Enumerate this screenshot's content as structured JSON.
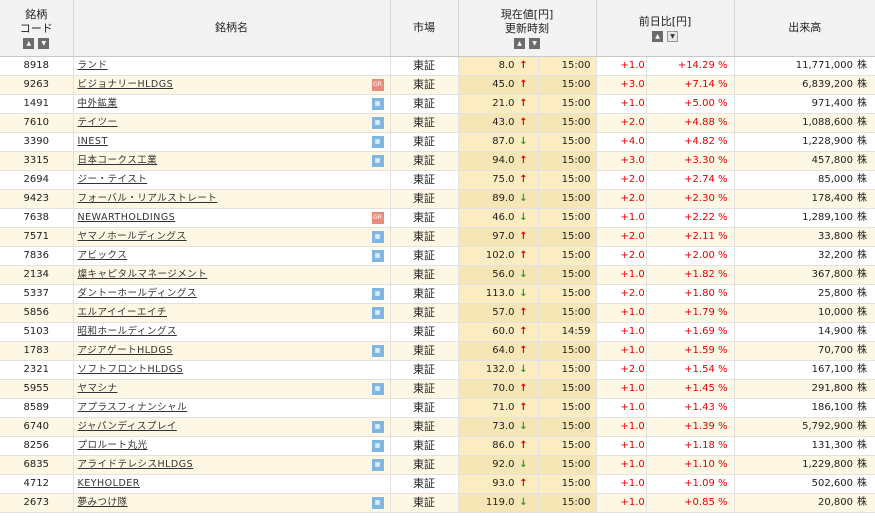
{
  "header": {
    "code_line1": "銘柄",
    "code_line2": "コード",
    "name": "銘柄名",
    "market": "市場",
    "price_line1": "現在値[円]",
    "price_line2": "更新時刻",
    "change": "前日比[円]",
    "volume": "出来高"
  },
  "volume_unit": "株",
  "rows": [
    {
      "code": "8918",
      "name": "ランド",
      "badge": "",
      "market": "東証",
      "price": "8.0",
      "dir": "up",
      "time": "15:00",
      "change": "+1.0",
      "pct": "+14.29 %",
      "volume": "11,771,000"
    },
    {
      "code": "9263",
      "name": "ビジョナリーHLDGS",
      "badge": "GR",
      "market": "東証",
      "price": "45.0",
      "dir": "up",
      "time": "15:00",
      "change": "+3.0",
      "pct": "+7.14 %",
      "volume": "6,839,200"
    },
    {
      "code": "1491",
      "name": "中外鉱業",
      "badge": "chart",
      "market": "東証",
      "price": "21.0",
      "dir": "up",
      "time": "15:00",
      "change": "+1.0",
      "pct": "+5.00 %",
      "volume": "971,400"
    },
    {
      "code": "7610",
      "name": "テイツー",
      "badge": "chart",
      "market": "東証",
      "price": "43.0",
      "dir": "up",
      "time": "15:00",
      "change": "+2.0",
      "pct": "+4.88 %",
      "volume": "1,088,600"
    },
    {
      "code": "3390",
      "name": "INEST",
      "badge": "chart",
      "market": "東証",
      "price": "87.0",
      "dir": "down",
      "time": "15:00",
      "change": "+4.0",
      "pct": "+4.82 %",
      "volume": "1,228,900"
    },
    {
      "code": "3315",
      "name": "日本コークス工業",
      "badge": "chart",
      "market": "東証",
      "price": "94.0",
      "dir": "up",
      "time": "15:00",
      "change": "+3.0",
      "pct": "+3.30 %",
      "volume": "457,800"
    },
    {
      "code": "2694",
      "name": "ジー・テイスト",
      "badge": "",
      "market": "東証",
      "price": "75.0",
      "dir": "up",
      "time": "15:00",
      "change": "+2.0",
      "pct": "+2.74 %",
      "volume": "85,000"
    },
    {
      "code": "9423",
      "name": "フォーバル・リアルストレート",
      "badge": "",
      "market": "東証",
      "price": "89.0",
      "dir": "down",
      "time": "15:00",
      "change": "+2.0",
      "pct": "+2.30 %",
      "volume": "178,400"
    },
    {
      "code": "7638",
      "name": "NEWARTHOLDINGS",
      "badge": "GR",
      "market": "東証",
      "price": "46.0",
      "dir": "down",
      "time": "15:00",
      "change": "+1.0",
      "pct": "+2.22 %",
      "volume": "1,289,100"
    },
    {
      "code": "7571",
      "name": "ヤマノホールディングス",
      "badge": "chart",
      "market": "東証",
      "price": "97.0",
      "dir": "up",
      "time": "15:00",
      "change": "+2.0",
      "pct": "+2.11 %",
      "volume": "33,800"
    },
    {
      "code": "7836",
      "name": "アビックス",
      "badge": "chart",
      "market": "東証",
      "price": "102.0",
      "dir": "up",
      "time": "15:00",
      "change": "+2.0",
      "pct": "+2.00 %",
      "volume": "32,200"
    },
    {
      "code": "2134",
      "name": "燦キャピタルマネージメント",
      "badge": "",
      "market": "東証",
      "price": "56.0",
      "dir": "down",
      "time": "15:00",
      "change": "+1.0",
      "pct": "+1.82 %",
      "volume": "367,800"
    },
    {
      "code": "5337",
      "name": "ダントーホールディングス",
      "badge": "chart",
      "market": "東証",
      "price": "113.0",
      "dir": "down",
      "time": "15:00",
      "change": "+2.0",
      "pct": "+1.80 %",
      "volume": "25,800"
    },
    {
      "code": "5856",
      "name": "エルアイイーエイチ",
      "badge": "chart",
      "market": "東証",
      "price": "57.0",
      "dir": "up",
      "time": "15:00",
      "change": "+1.0",
      "pct": "+1.79 %",
      "volume": "10,000"
    },
    {
      "code": "5103",
      "name": "昭和ホールディングス",
      "badge": "",
      "market": "東証",
      "price": "60.0",
      "dir": "up",
      "time": "14:59",
      "change": "+1.0",
      "pct": "+1.69 %",
      "volume": "14,900"
    },
    {
      "code": "1783",
      "name": "アジアゲートHLDGS",
      "badge": "chart",
      "market": "東証",
      "price": "64.0",
      "dir": "up",
      "time": "15:00",
      "change": "+1.0",
      "pct": "+1.59 %",
      "volume": "70,700"
    },
    {
      "code": "2321",
      "name": "ソフトフロントHLDGS",
      "badge": "",
      "market": "東証",
      "price": "132.0",
      "dir": "down",
      "time": "15:00",
      "change": "+2.0",
      "pct": "+1.54 %",
      "volume": "167,100"
    },
    {
      "code": "5955",
      "name": "ヤマシナ",
      "badge": "chart",
      "market": "東証",
      "price": "70.0",
      "dir": "up",
      "time": "15:00",
      "change": "+1.0",
      "pct": "+1.45 %",
      "volume": "291,800"
    },
    {
      "code": "8589",
      "name": "アプラスフィナンシャル",
      "badge": "",
      "market": "東証",
      "price": "71.0",
      "dir": "up",
      "time": "15:00",
      "change": "+1.0",
      "pct": "+1.43 %",
      "volume": "186,100"
    },
    {
      "code": "6740",
      "name": "ジャパンディスプレイ",
      "badge": "chart",
      "market": "東証",
      "price": "73.0",
      "dir": "down",
      "time": "15:00",
      "change": "+1.0",
      "pct": "+1.39 %",
      "volume": "5,792,900"
    },
    {
      "code": "8256",
      "name": "プロルート丸光",
      "badge": "chart",
      "market": "東証",
      "price": "86.0",
      "dir": "up",
      "time": "15:00",
      "change": "+1.0",
      "pct": "+1.18 %",
      "volume": "131,300"
    },
    {
      "code": "6835",
      "name": "アライドテレシスHLDGS",
      "badge": "chart",
      "market": "東証",
      "price": "92.0",
      "dir": "down",
      "time": "15:00",
      "change": "+1.0",
      "pct": "+1.10 %",
      "volume": "1,229,800"
    },
    {
      "code": "4712",
      "name": "KEYHOLDER",
      "badge": "",
      "market": "東証",
      "price": "93.0",
      "dir": "up",
      "time": "15:00",
      "change": "+1.0",
      "pct": "+1.09 %",
      "volume": "502,600"
    },
    {
      "code": "2673",
      "name": "夢みつけ隊",
      "badge": "chart",
      "market": "東証",
      "price": "119.0",
      "dir": "down",
      "time": "15:00",
      "change": "+1.0",
      "pct": "+0.85 %",
      "volume": "20,800"
    }
  ]
}
